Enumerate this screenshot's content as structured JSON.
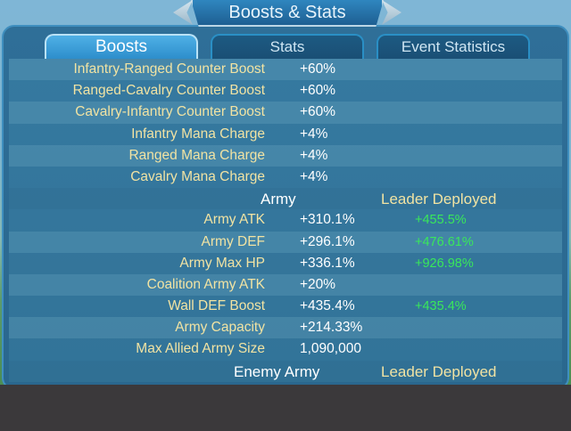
{
  "window": {
    "title": "Boosts & Stats"
  },
  "tabs": [
    {
      "label": "Boosts",
      "active": true
    },
    {
      "label": "Stats",
      "active": false
    },
    {
      "label": "Event Statistics",
      "active": false
    }
  ],
  "boosts": [
    {
      "label": "Infantry-Ranged Counter Boost",
      "value": "+60%"
    },
    {
      "label": "Ranged-Cavalry Counter Boost",
      "value": "+60%"
    },
    {
      "label": "Cavalry-Infantry Counter Boost",
      "value": "+60%"
    },
    {
      "label": "Infantry Mana Charge",
      "value": "+4%"
    },
    {
      "label": "Ranged Mana Charge",
      "value": "+4%"
    },
    {
      "label": "Cavalry Mana Charge",
      "value": "+4%"
    }
  ],
  "army_section": {
    "header": "Army",
    "leader_header": "Leader Deployed",
    "rows": [
      {
        "label": "Army ATK",
        "value": "+310.1%",
        "leader": "+455.5%"
      },
      {
        "label": "Army DEF",
        "value": "+296.1%",
        "leader": "+476.61%"
      },
      {
        "label": "Army Max HP",
        "value": "+336.1%",
        "leader": "+926.98%"
      },
      {
        "label": "Coalition Army ATK",
        "value": "+20%",
        "leader": ""
      },
      {
        "label": "Wall DEF Boost",
        "value": "+435.4%",
        "leader": "+435.4%"
      },
      {
        "label": "Army Capacity",
        "value": "+214.33%",
        "leader": ""
      },
      {
        "label": "Max Allied Army Size",
        "value": "1,090,000",
        "leader": ""
      }
    ]
  },
  "enemy_section": {
    "header": "Enemy Army",
    "leader_header": "Leader Deployed"
  },
  "colors": {
    "label_text": "#f1e3a3",
    "value_text": "#ffffff",
    "leader_text": "#39e85a",
    "active_tab": "#3a9fd9",
    "panel": "#2f6f98"
  }
}
